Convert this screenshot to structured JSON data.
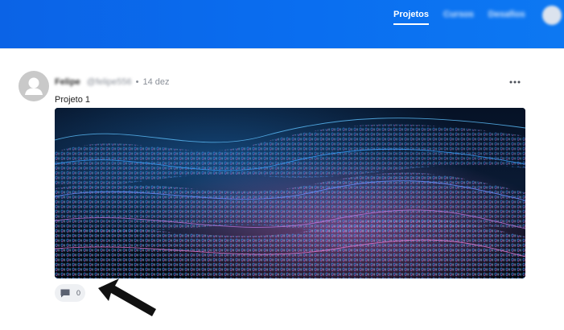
{
  "nav": {
    "links": [
      {
        "label": "Projetos",
        "active": true
      },
      {
        "label": "Cursos",
        "active": false
      },
      {
        "label": "Desafios",
        "active": false
      }
    ],
    "bar_color": "#0b63e6"
  },
  "post": {
    "author_name": "Felipe",
    "author_handle": "@felipe556",
    "separator": "•",
    "date": "14 dez",
    "title": "Projeto 1",
    "image_description_icon": "binary-wave-image",
    "comments_count": "0"
  },
  "icons": {
    "more": "more-horizontal-icon",
    "comment": "comment-icon",
    "avatar": "user-placeholder-icon"
  }
}
